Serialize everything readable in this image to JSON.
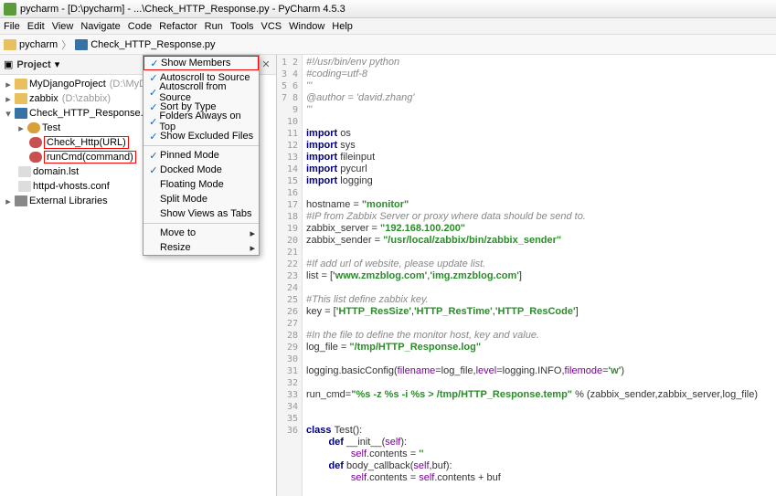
{
  "window": {
    "title": "pycharm - [D:\\pycharm] - ...\\Check_HTTP_Response.py - PyCharm 4.5.3"
  },
  "menu": {
    "items": [
      "File",
      "Edit",
      "View",
      "Navigate",
      "Code",
      "Refactor",
      "Run",
      "Tools",
      "VCS",
      "Window",
      "Help"
    ]
  },
  "breadcrumb": {
    "root": "pycharm",
    "file": "Check_HTTP_Response.py"
  },
  "sidebar": {
    "title": "Project"
  },
  "tree": {
    "project1": "MyDjangoProject",
    "project1_hint": "(D:\\MyDjan",
    "project2": "zabbix",
    "project2_hint": "(D:\\zabbix)",
    "file_main": "Check_HTTP_Response.py",
    "class_test": "Test",
    "fn1": "Check_Http(URL)",
    "fn2": "runCmd(command)",
    "file_domain": "domain.lst",
    "file_vhosts": "httpd-vhosts.conf",
    "ext_lib": "External Libraries"
  },
  "context_menu": {
    "show_members": "Show Members",
    "autoscroll_to": "Autoscroll to Source",
    "autoscroll_from": "Autoscroll from Source",
    "sort_by_type": "Sort by Type",
    "folders_top": "Folders Always on Top",
    "show_excluded": "Show Excluded Files",
    "pinned": "Pinned Mode",
    "docked": "Docked Mode",
    "floating": "Floating Mode",
    "split": "Split Mode",
    "show_views": "Show Views as Tabs",
    "move_to": "Move to",
    "resize": "Resize"
  },
  "code": {
    "l1": "#!/usr/bin/env python",
    "l2": "#coding=utf-8",
    "l3": "'''",
    "l4": "@author = 'david.zhang'",
    "l5": "'''",
    "l6": "",
    "l7a": "import",
    "l7b": " os",
    "l8a": "import",
    "l8b": " sys",
    "l9a": "import",
    "l9b": " fileinput",
    "l10a": "import",
    "l10b": " pycurl",
    "l11a": "import",
    "l11b": " logging",
    "l12": "",
    "l13a": "hostname = ",
    "l13b": "\"monitor\"",
    "l14": "#IP from Zabbix Server or proxy where data should be send to.",
    "l15a": "zabbix_server = ",
    "l15b": "\"192.168.100.200\"",
    "l16a": "zabbix_sender = ",
    "l16b": "\"/usr/local/zabbix/bin/zabbix_sender\"",
    "l17": "",
    "l18": "#If add url of website, please update list.",
    "l19a": "list = [",
    "l19b": "'www.zmzblog.com'",
    "l19c": ",",
    "l19d": "'img.zmzblog.com'",
    "l19e": "]",
    "l20": "",
    "l21": "#This list define zabbix key.",
    "l22a": "key = [",
    "l22b": "'HTTP_ResSize'",
    "l22c": ",",
    "l22d": "'HTTP_ResTime'",
    "l22e": ",",
    "l22f": "'HTTP_ResCode'",
    "l22g": "]",
    "l23": "",
    "l24": "#In the file to define the monitor host, key and value.",
    "l25a": "log_file = ",
    "l25b": "\"/tmp/HTTP_Response.log\"",
    "l26": "",
    "l27a": "logging.basicConfig(",
    "l27b": "filename",
    "l27c": "=log_file,",
    "l27d": "level",
    "l27e": "=logging.INFO,",
    "l27f": "filemode",
    "l27g": "=",
    "l27h": "'w'",
    "l27i": ")",
    "l28": "",
    "l29a": "run_cmd=",
    "l29b": "\"%s -z %s -i %s > /tmp/HTTP_Response.temp\"",
    "l29c": " % (zabbix_sender,zabbix_server,log_file)",
    "l30": "",
    "l31": "",
    "l32a": "class ",
    "l32b": "Test",
    "l32c": "():",
    "l33a": "        def ",
    "l33b": "__init__",
    "l33c": "(",
    "l33d": "self",
    "l33e": "):",
    "l34a": "                ",
    "l34b": "self",
    "l34c": ".contents = ",
    "l34d": "''",
    "l35a": "        def ",
    "l35b": "body_callback",
    "l35c": "(",
    "l35d": "self",
    "l35e": ",buf):",
    "l36a": "                ",
    "l36b": "self",
    "l36c": ".contents = ",
    "l36d": "self",
    "l36e": ".contents + buf"
  }
}
